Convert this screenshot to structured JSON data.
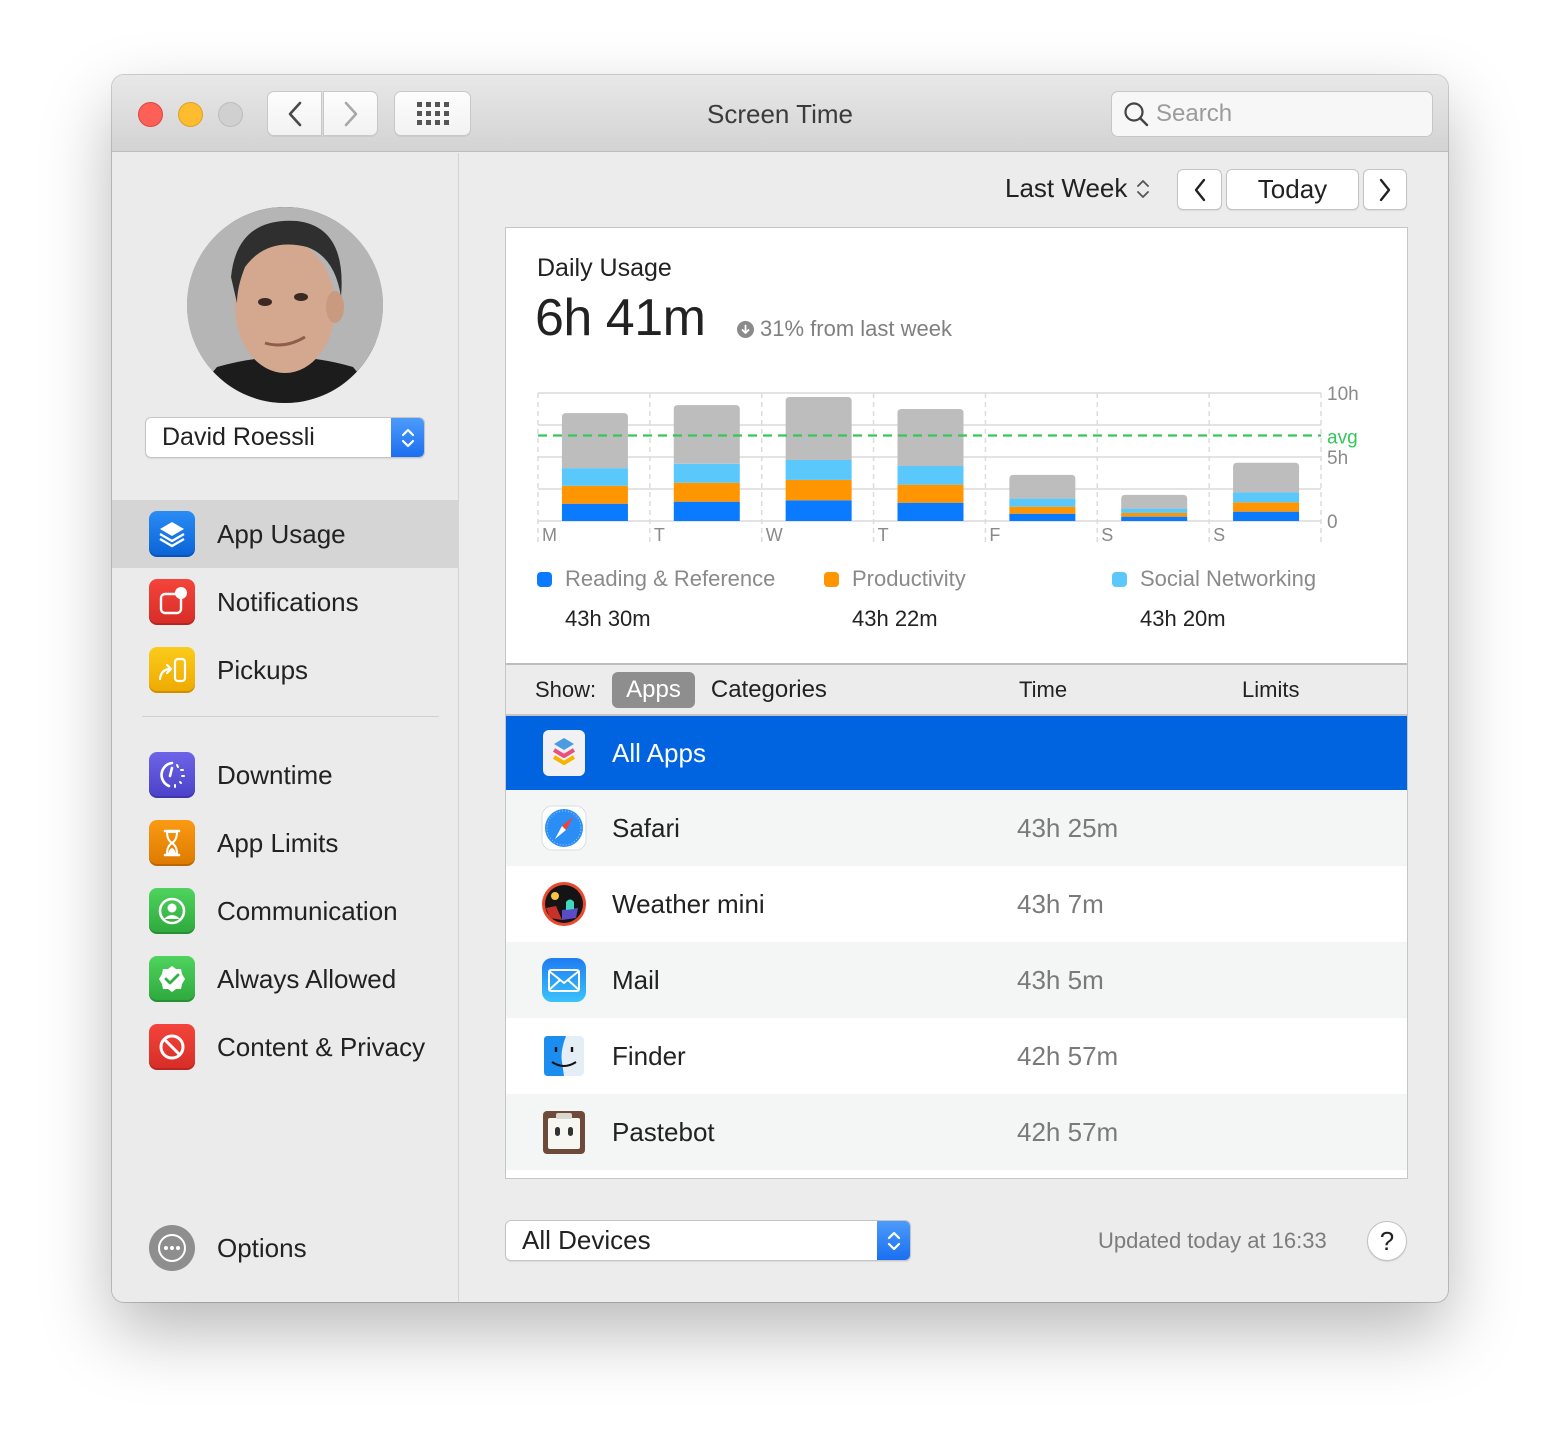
{
  "window": {
    "title": "Screen Time",
    "search_placeholder": "Search"
  },
  "sidebar": {
    "user": "David Roessli",
    "items": [
      {
        "label": "App Usage",
        "icon": "layers-icon",
        "color": "#1a73e8",
        "selected": true
      },
      {
        "label": "Notifications",
        "icon": "notification-badge-icon",
        "color": "#e8352e"
      },
      {
        "label": "Pickups",
        "icon": "pickup-phone-icon",
        "color": "#f5bd00"
      },
      {
        "label": "Downtime",
        "icon": "downtime-clock-icon",
        "color": "#5a52d6"
      },
      {
        "label": "App Limits",
        "icon": "hourglass-icon",
        "color": "#ef8a00"
      },
      {
        "label": "Communication",
        "icon": "person-circle-icon",
        "color": "#3cb54a"
      },
      {
        "label": "Always Allowed",
        "icon": "checkmark-seal-icon",
        "color": "#3cb54a"
      },
      {
        "label": "Content & Privacy",
        "icon": "prohibited-icon",
        "color": "#e33a31"
      }
    ],
    "options_label": "Options"
  },
  "toolbar": {
    "period": "Last Week",
    "today_label": "Today"
  },
  "summary": {
    "label": "Daily Usage",
    "value": "6h 41m",
    "change": "31% from last week",
    "change_direction": "down"
  },
  "chart_data": {
    "type": "bar",
    "stacked": true,
    "title": "Daily Usage",
    "categories": [
      "M",
      "T",
      "W",
      "T",
      "F",
      "S",
      "S"
    ],
    "y_ticks": [
      "10h",
      "5h",
      "0"
    ],
    "ylim": [
      0,
      10
    ],
    "yunit": "hours",
    "average": 6.68,
    "average_label": "avg",
    "series": [
      {
        "name": "Reading & Reference",
        "color": "#0a7aff",
        "values": [
          1.35,
          1.51,
          1.62,
          1.43,
          0.57,
          0.34,
          0.73
        ]
      },
      {
        "name": "Productivity",
        "color": "#ff9500",
        "values": [
          1.4,
          1.48,
          1.59,
          1.41,
          0.55,
          0.29,
          0.73
        ]
      },
      {
        "name": "Social Networking",
        "color": "#5ac8fa",
        "values": [
          1.38,
          1.48,
          1.56,
          1.46,
          0.63,
          0.34,
          0.78
        ]
      },
      {
        "name": "Other",
        "color": "#bdbdbd",
        "values": [
          4.3,
          4.58,
          4.92,
          4.45,
          1.85,
          1.07,
          2.31
        ]
      }
    ],
    "grid": true,
    "legend": "bottom"
  },
  "legend": [
    {
      "name": "Reading & Reference",
      "total": "43h 30m",
      "color": "#0a7aff"
    },
    {
      "name": "Productivity",
      "total": "43h 22m",
      "color": "#ff9500"
    },
    {
      "name": "Social Networking",
      "total": "43h 20m",
      "color": "#5ac8fa"
    }
  ],
  "list": {
    "show_label": "Show:",
    "tabs": [
      "Apps",
      "Categories"
    ],
    "active_tab": "Apps",
    "col_time": "Time",
    "col_limits": "Limits",
    "rows": [
      {
        "name": "All Apps",
        "time": "",
        "icon": "all-apps-icon",
        "selected": true
      },
      {
        "name": "Safari",
        "time": "43h 25m",
        "icon": "safari-icon"
      },
      {
        "name": "Weather mini",
        "time": "43h 7m",
        "icon": "weather-mini-icon"
      },
      {
        "name": "Mail",
        "time": "43h 5m",
        "icon": "mail-icon"
      },
      {
        "name": "Finder",
        "time": "42h 57m",
        "icon": "finder-icon"
      },
      {
        "name": "Pastebot",
        "time": "42h 57m",
        "icon": "pastebot-icon"
      }
    ]
  },
  "footer": {
    "devices": "All Devices",
    "updated": "Updated today at 16:33",
    "help": "?"
  }
}
